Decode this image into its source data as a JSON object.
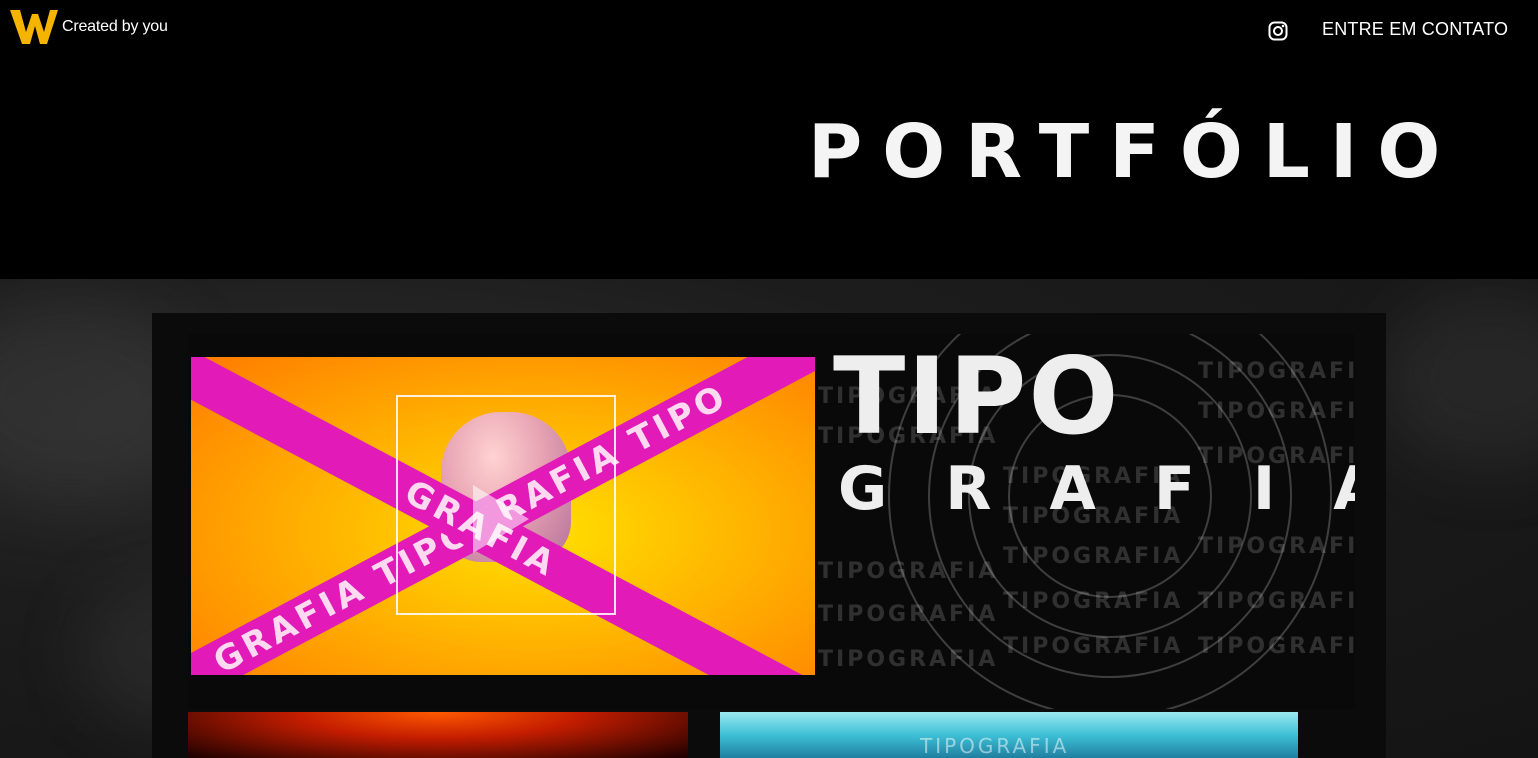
{
  "header": {
    "brand_text": "Created by you",
    "contact_label": "ENTRE EM CONTATO",
    "instagram_icon": "instagram-icon",
    "logo_color": "#f5b400"
  },
  "hero": {
    "title": "PORTFÓLIO"
  },
  "featured": {
    "title_line1": "TIPO",
    "title_line2": "GRAFIA",
    "thumbnail_tape_1": "GRAFIA TIPOGRAFIA TIPO",
    "thumbnail_tape_2": "GRAFIA",
    "ghost_word": "TIPOGRAFIA",
    "play_icon": "play-icon",
    "tape_color": "#e21bb8"
  },
  "second_row": {
    "thumb3_text": "TIPOGRAFIA"
  }
}
